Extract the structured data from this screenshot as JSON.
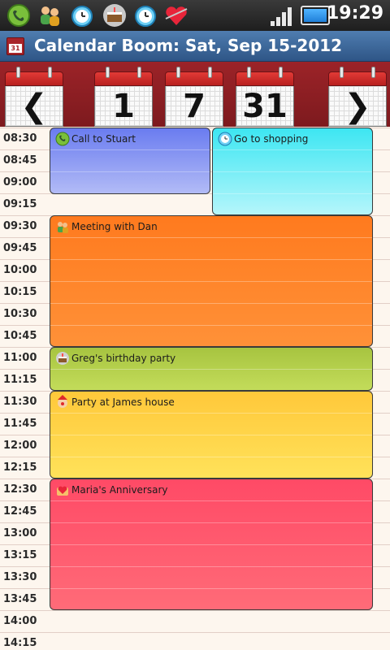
{
  "status_bar": {
    "time": "19:29",
    "notification_icons": [
      "phone-icon",
      "contacts-icon",
      "alarm-clock-icon",
      "birthday-cake-icon",
      "alarm-clock-icon",
      "heart-icon"
    ]
  },
  "title_bar": {
    "title": "Calendar Boom: Sat, Sep 15-2012"
  },
  "nav": {
    "prev_label": "❮",
    "view_day_label": "1",
    "view_week_label": "7",
    "view_month_label": "31",
    "next_label": "❯"
  },
  "schedule": {
    "times": [
      "08:30",
      "08:45",
      "09:00",
      "09:15",
      "09:30",
      "09:45",
      "10:00",
      "10:15",
      "10:30",
      "10:45",
      "11:00",
      "11:15",
      "11:30",
      "11:45",
      "12:00",
      "12:15",
      "12:30",
      "12:45",
      "13:00",
      "13:15",
      "13:30",
      "13:45",
      "14:00",
      "14:15"
    ]
  },
  "events": [
    {
      "title": "Call to Stuart",
      "start": "08:30",
      "end": "09:30",
      "icon": "phone-icon",
      "color_top": "#6a7cf0",
      "color_bottom": "#b2bbf6"
    },
    {
      "title": "Go to shopping",
      "start": "08:30",
      "end": "09:30",
      "icon": "alarm-clock-icon",
      "color_top": "#3de6f2",
      "color_bottom": "#b5f6fb"
    },
    {
      "title": "Meeting with Dan",
      "start": "09:30",
      "end": "11:00",
      "icon": "contacts-icon",
      "color_top": "#ff7a1e",
      "color_bottom": "#ff9138"
    },
    {
      "title": "Greg's birthday party",
      "start": "11:00",
      "end": "11:30",
      "icon": "birthday-cake-icon",
      "color_top": "#a7c440",
      "color_bottom": "#c3dc5a"
    },
    {
      "title": "Party at James house",
      "start": "11:30",
      "end": "12:30",
      "icon": "clown-icon",
      "color_top": "#ffc83a",
      "color_bottom": "#ffe25a"
    },
    {
      "title": "Maria's Anniversary",
      "start": "12:30",
      "end": "14:00",
      "icon": "heart-icon",
      "color_top": "#ff4a66",
      "color_bottom": "#ff6b78"
    }
  ]
}
